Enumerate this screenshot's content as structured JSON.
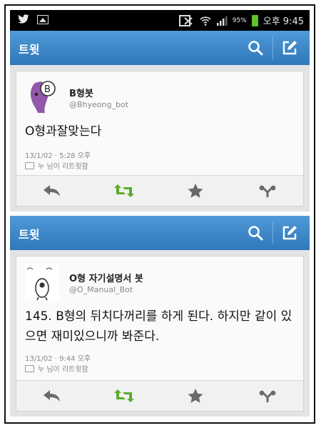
{
  "statusbar": {
    "battery": "95%",
    "time": "오후 9:45",
    "icons": [
      "twitter-bird-icon",
      "gallery-icon",
      "sim-icon",
      "wifi-icon",
      "signal-icon",
      "battery-icon"
    ]
  },
  "screens": [
    {
      "actionbar": {
        "title": "트윗"
      },
      "tweet": {
        "name": "B형봇",
        "handle": "@Bhyeong_bot",
        "text": "O형과잘맞는다",
        "timestamp": "13/1/02 · 5:28 오후",
        "retweet_note": "누 님이 리트윗함"
      }
    },
    {
      "actionbar": {
        "title": "트윗"
      },
      "tweet": {
        "name": "O형 자기설명서 봇",
        "handle": "@O_Manual_Bot",
        "text": "145. B형의 뒤치다꺼리를 하게 된다. 하지만 같이 있으면 재미있으니까 봐준다.",
        "timestamp": "13/1/02 · 9:44 오후",
        "retweet_note": "누 님이 리트윗함"
      }
    }
  ],
  "colors": {
    "actionbar": "#3b86c8",
    "retweet": "#5bab2a",
    "action_icons": "#6a6a6a"
  }
}
